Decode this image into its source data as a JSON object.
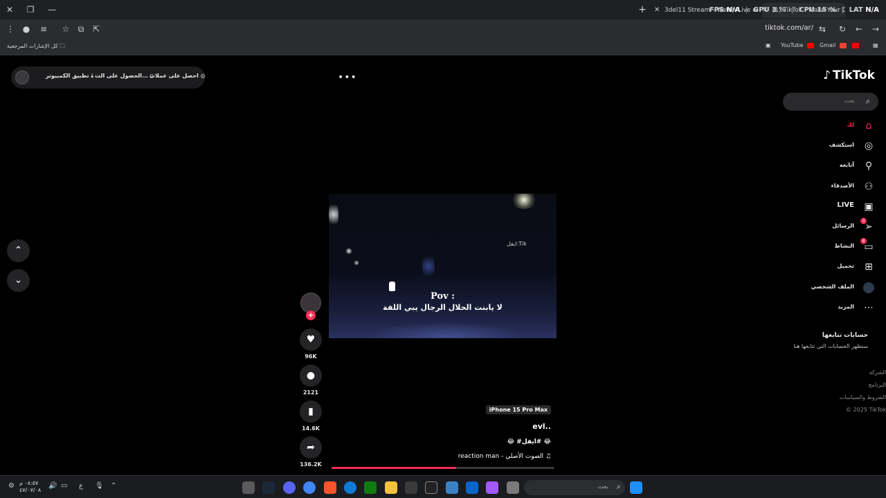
{
  "browser": {
    "tabs": [
      {
        "title": "3del11 Stream - Watch Live on"
      },
      {
        "title": "(1) TikTok - Make Your Day"
      }
    ],
    "overlay": {
      "fps_label": "FPS",
      "fps_value": "N/A",
      "gpu_label": "GPU",
      "gpu_value": "3 %",
      "cpu_label": "CPU",
      "cpu_value": "15 %",
      "lat_label": "LAT",
      "lat_value": "N/A"
    },
    "url": "tiktok.com/ar/",
    "bookmarks": {
      "all_bookmarks": "كل الإشارات المرجعية",
      "youtube": "YouTube",
      "gmail": "Gmail"
    }
  },
  "page": {
    "top_actions": {
      "desktop_app": "تطبيق الكمبيوتر",
      "get_app": "الحصول على الت...",
      "get_coins": "احصل على عملات"
    },
    "logo": "TikTok",
    "search": {
      "placeholder": "بحث"
    },
    "nav": [
      {
        "label": "لك",
        "icon": "home-icon"
      },
      {
        "label": "استكشف",
        "icon": "compass-icon"
      },
      {
        "label": "أتابعه",
        "icon": "user-plus-icon"
      },
      {
        "label": "الأصدقاء",
        "icon": "friends-icon"
      },
      {
        "label": "LIVE",
        "icon": "live-tv-icon"
      },
      {
        "label": "الرسائل",
        "icon": "paper-plane-icon",
        "badge": "3"
      },
      {
        "label": "النشاط",
        "icon": "inbox-icon",
        "badge": "8"
      },
      {
        "label": "تحميل",
        "icon": "plus-square-icon"
      },
      {
        "label": "الملف الشخصي",
        "icon": "profile-avatar"
      },
      {
        "label": "المزيد",
        "icon": "more-dots-icon"
      }
    ],
    "following": {
      "title": "حسابات تتابعها",
      "subtitle": "ستظهر الحسابات التي تتابعها هنا"
    },
    "footer": [
      "الشركة",
      "البرنامج",
      "الشروط والسياسات",
      "© 2025 TikTok"
    ],
    "video": {
      "watermark": "ايفل:Tik",
      "caption_line1": "Pov :",
      "caption_line2": "لا يابنت الحلال الرجال يبي اللفة",
      "progress": 0.56
    },
    "actions": {
      "likes": "96K",
      "comments": "2121",
      "saves": "14.6K",
      "shares": "136.2K"
    },
    "meta": {
      "device_tag": "iPhone 15 Pro Max",
      "username": "evl..",
      "hashtags": "😂 #ايفل# 😂",
      "sound": "reaction man - الصوت الأصلي"
    }
  },
  "taskbar": {
    "search_placeholder": "بحث",
    "clock_time": "٠٨:٥٧ م",
    "clock_date": "٤٧/٠٧/٠٨",
    "lang": "ع"
  }
}
